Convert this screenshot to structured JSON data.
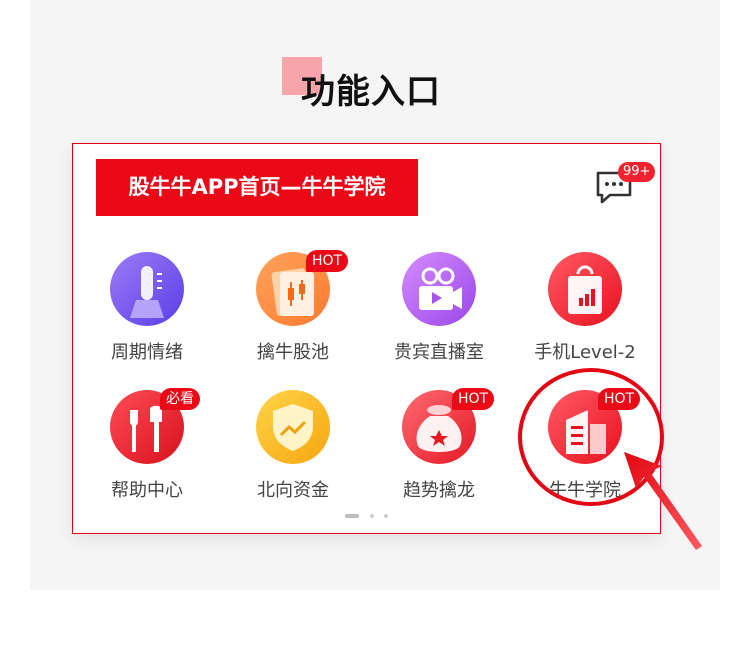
{
  "heading": "功能入口",
  "card": {
    "banner_title": "股牛牛APP首页—牛牛学院",
    "message_badge": "99+",
    "items": [
      {
        "label": "周期情绪",
        "tag": "",
        "icon": "thermometer-icon"
      },
      {
        "label": "擒牛股池",
        "tag": "HOT",
        "icon": "candlestick-chart-icon"
      },
      {
        "label": "贵宾直播室",
        "tag": "",
        "icon": "video-camera-icon"
      },
      {
        "label": "手机Level-2",
        "tag": "",
        "icon": "shopping-bag-chart-icon"
      },
      {
        "label": "帮助中心",
        "tag": "必看",
        "icon": "tools-icon"
      },
      {
        "label": "北向资金",
        "tag": "",
        "icon": "shield-trend-icon"
      },
      {
        "label": "趋势擒龙",
        "tag": "HOT",
        "icon": "money-bag-icon"
      },
      {
        "label": "牛牛学院",
        "tag": "HOT",
        "icon": "building-icon"
      }
    ]
  },
  "pager": {
    "pages": 3,
    "active": 1
  },
  "colors": {
    "brand_red": "#ea0a17",
    "panel_bg": "#f5f5f6",
    "highlight": "#e30613"
  }
}
